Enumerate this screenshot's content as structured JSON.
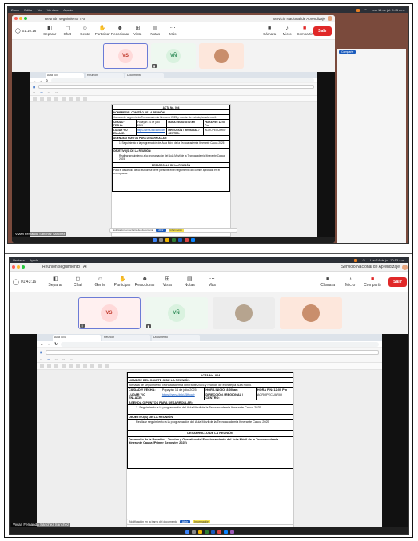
{
  "shots": [
    {
      "menubar": {
        "items": [
          "Zoom",
          "Editar",
          "Ver",
          "Ventana",
          "Ayuda"
        ],
        "clock": "Lun 14 de jul. 9:45 a.m."
      },
      "zoom": {
        "title": "Reunión seguimiento TAI",
        "org": "Servicio Nacional de Aprendizaje",
        "timer": "01:10:16",
        "tools": [
          "Separar",
          "Chat",
          "Gente",
          "Participar",
          "Reaccionar",
          "Vista",
          "Notas",
          "Más"
        ],
        "right_tools": [
          "Cámara",
          "Micro",
          "Compartir"
        ],
        "leave": "Salir",
        "tiles": [
          {
            "initials": "VS",
            "bg": "#ffd9d9",
            "fg": "#c0392b"
          },
          {
            "initials": "VÑ",
            "bg": "#d9f2df",
            "fg": "#2e8b57"
          }
        ]
      },
      "doc": {
        "title": "ACTA No. 004",
        "rows": [
          [
            "NOMBRE DEL COMITÉ O DE LA REUNIÓN:"
          ],
          [
            "Jornada de seguimiento Tecnoacademia Itinerante 2025 y reunión de estrategia Aula móvil."
          ],
          [
            "CIUDAD Y FECHA:",
            "Popayán 14 de julio 2025",
            "HORA INICIO: 8:00 am",
            "HORA FIN: 12:00 Pm"
          ],
          [
            "LUGAR Y/O ENLACE:",
            "https://sena.link/z5f6ocfr",
            "DIRECCIÓN / REGIONAL / CENTRO:",
            "AGROPECUARIO"
          ],
          [
            "AGENDA O PUNTOS PARA DESARROLLAR:"
          ],
          [
            "1. Seguimiento a la programación del Aula Móvil de la Tecnoacademia Itinerante Cauca 2025"
          ],
          [
            "OBJETIVO(S) DE LA REUNIÓN:"
          ],
          [
            "Realizar seguimiento a la programación del Aula Móvil de la Tecnoacademia Itinerante Cauca 2025"
          ],
          [
            "DESARROLLO DE LA REUNIÓN"
          ],
          [
            "Para el desarrollo de la reunión se tiene presente en el seguimiento del comité aprobado en el cronograma."
          ]
        ]
      },
      "participant_name": "Vivian Fernanda Sánchez Sánchez",
      "notice": {
        "text": "Notificación en la barra del documento",
        "btn": "Abrir",
        "yellow": "Información"
      },
      "side_btn": "Comparte"
    },
    {
      "menubar": {
        "items": [
          "Ventana",
          "Ayuda"
        ],
        "clock": "Lun 14 de jul. 10:13 a.m."
      },
      "zoom": {
        "title": "Reunión seguimiento TAI",
        "org": "Servicio Nacional de Aprendizaje",
        "timer": "01:43:16",
        "tools": [
          "Separar",
          "Chat",
          "Gente",
          "Participar",
          "Reaccionar",
          "Vista",
          "Notas",
          "Más"
        ],
        "right_tools": [
          "Cámara",
          "Micro",
          "Compartir"
        ],
        "leave": "Salir",
        "tiles": [
          {
            "initials": "VS",
            "bg": "#ffd9d9",
            "fg": "#c0392b"
          },
          {
            "initials": "VÑ",
            "bg": "#d9f2df",
            "fg": "#2e8b57"
          }
        ]
      },
      "doc": {
        "title": "ACTA No. 004",
        "rows": [
          [
            "NOMBRE DEL COMITÉ O DE LA REUNIÓN:"
          ],
          [
            "Jornada de seguimiento Tecnoacademia Itinerante 2025 y reunión de estrategia Aula móvil."
          ],
          [
            "CIUDAD Y FECHA:",
            "Popayán 14 de julio 2025",
            "HORA INICIO: 8:00 am",
            "HORA FIN: 12:00 Pm"
          ],
          [
            "LUGAR Y/O ENLACE:",
            "https://sena.link/z5f6ocfr",
            "DIRECCIÓN / REGIONAL / CENTRO:",
            "AGROPECUARIO"
          ],
          [
            "AGENDA O PUNTOS PARA DESARROLLAR:"
          ],
          [
            "1. Seguimiento a la programación del Aula Móvil de la Tecnoacademia Itinerante Cauca 2025"
          ],
          [
            "OBJETIVO(S) DE LA REUNIÓN:"
          ],
          [
            "Realizar seguimiento a la programación del Aula Móvil de la Tecnoacademia Itinerante Cauca 2025"
          ],
          [
            "DESARROLLO DE LA REUNIÓN"
          ],
          [
            "Desarrollo de la Reunión – Tecnico y Operativo del Funcionamiento del Aula Móvil de la Tecnoacademia Itinerante Cauca (Primer Semestre 2025)"
          ]
        ]
      },
      "participant_name": "Vivian Fernanda Sánchez Sánchez",
      "notice": {
        "text": "Notificación en la barra del documento",
        "btn": "Abrir",
        "yellow": "Información"
      },
      "side_btn": ""
    }
  ]
}
